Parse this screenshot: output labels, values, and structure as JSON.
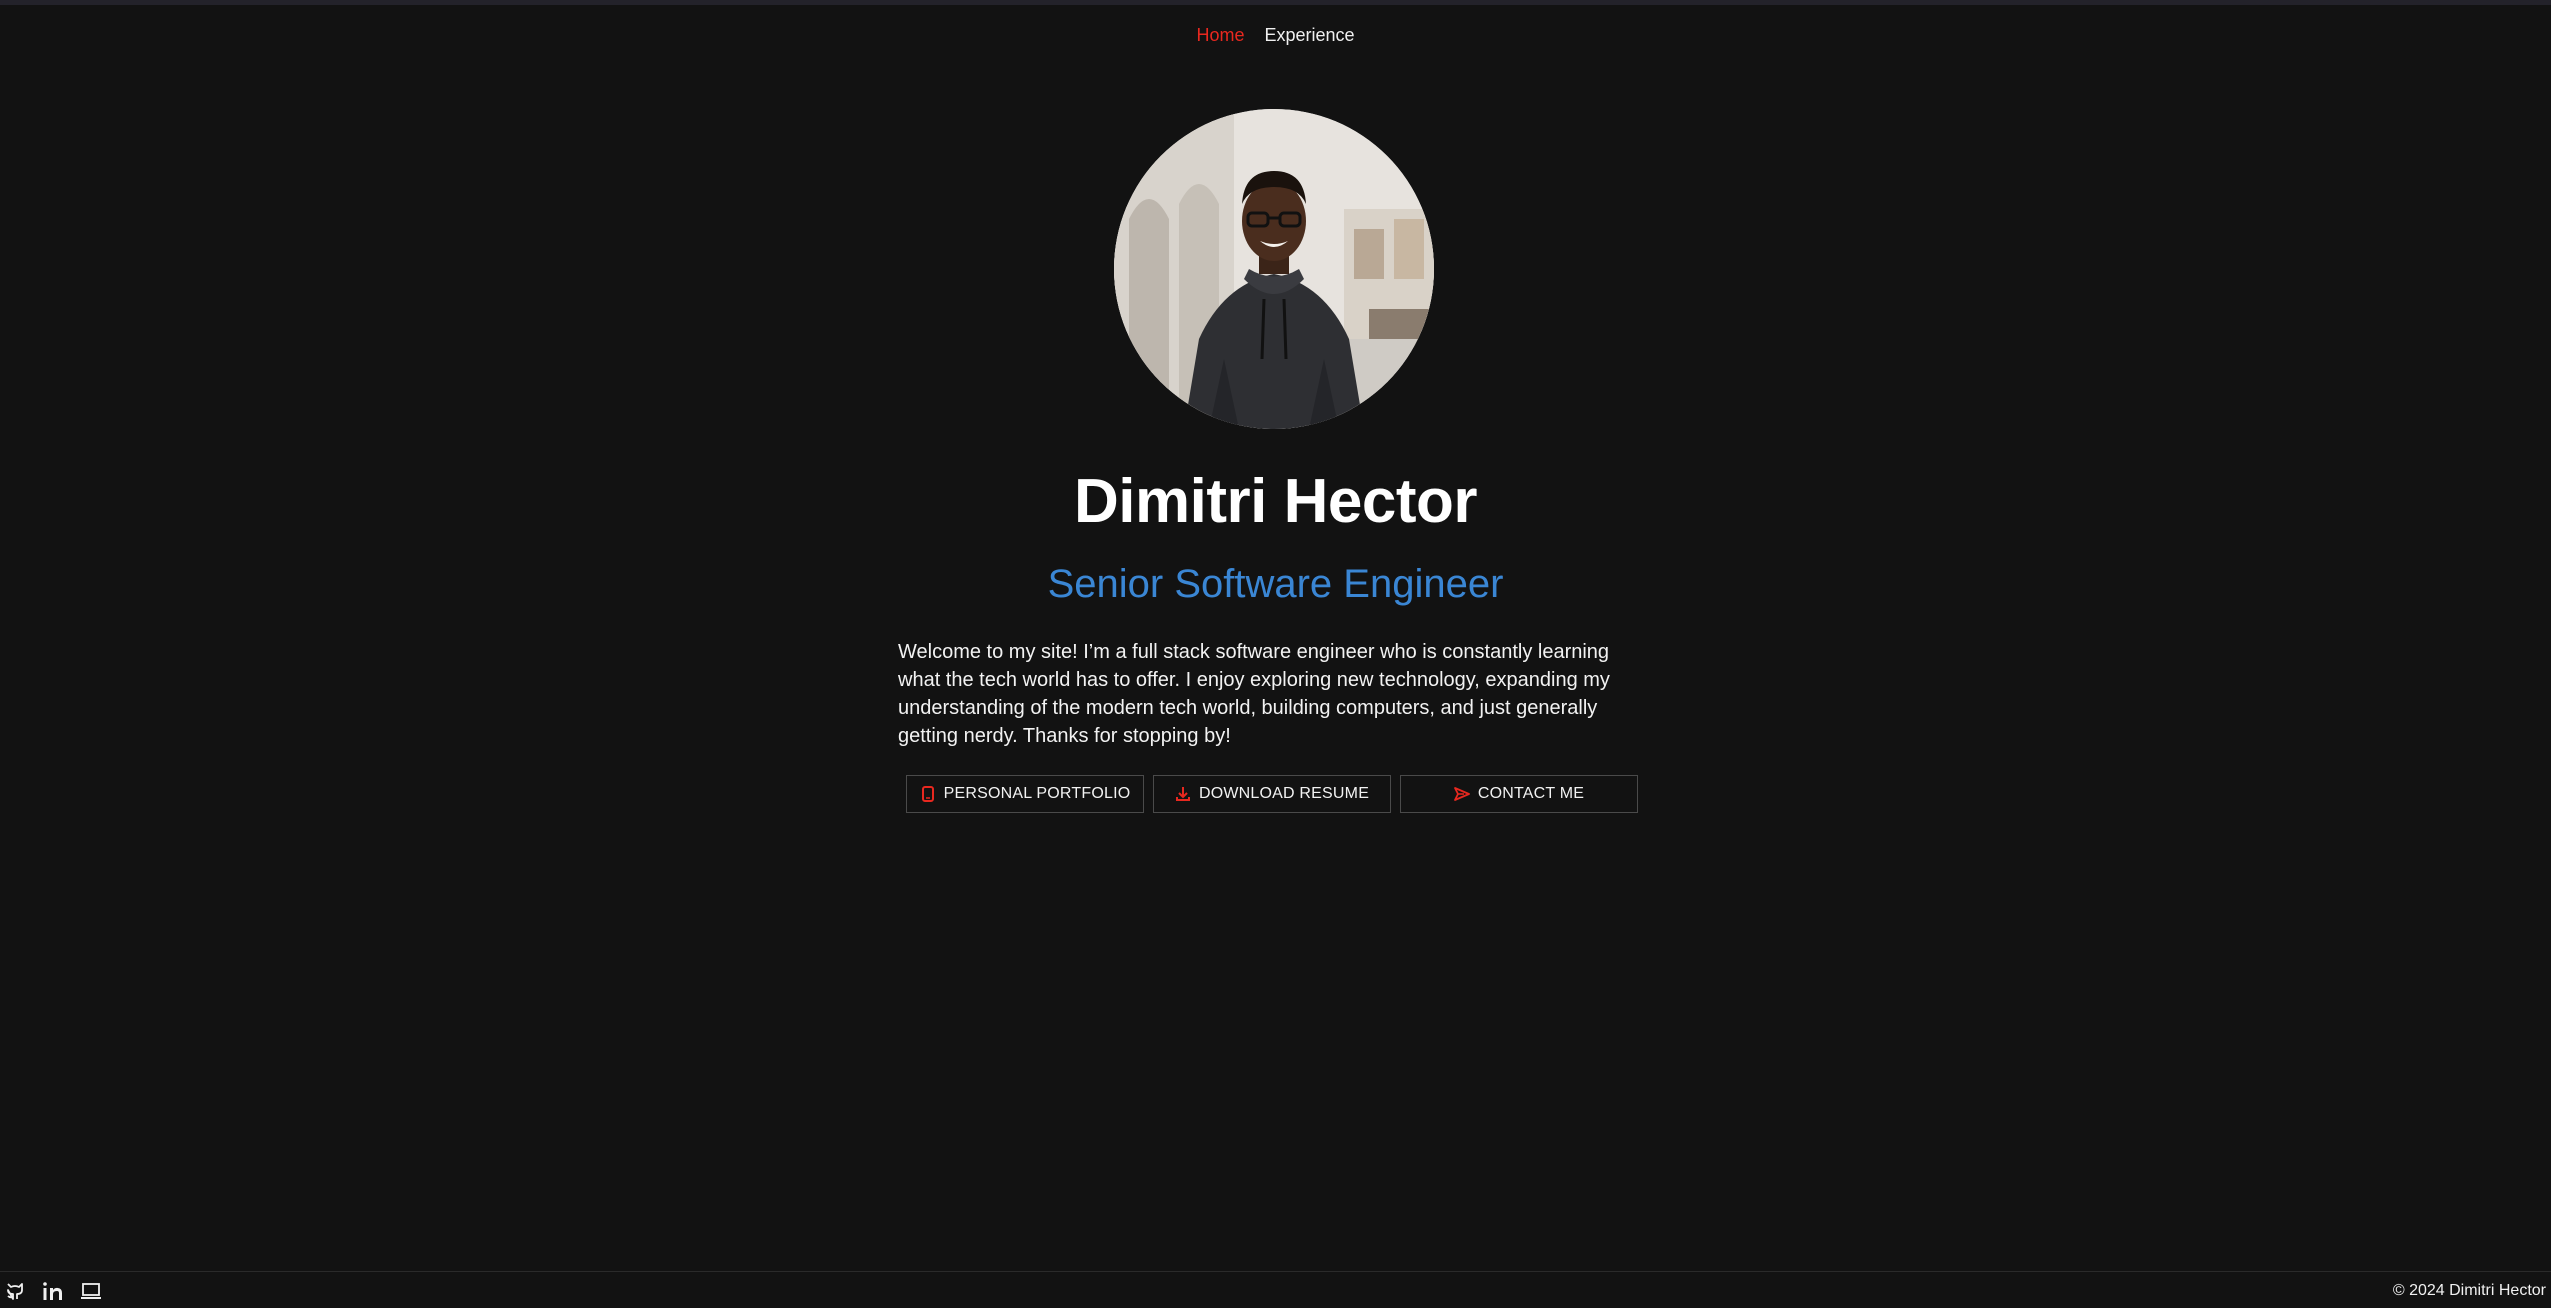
{
  "nav": {
    "items": [
      {
        "label": "Home",
        "active": true
      },
      {
        "label": "Experience",
        "active": false
      }
    ]
  },
  "profile": {
    "name": "Dimitri Hector",
    "role": "Senior Software Engineer",
    "bio": "Welcome to my site! I’m a full stack software engineer who is constantly learning what the tech world has to offer. I enjoy exploring new technology, expanding my understanding of the modern tech world, building computers, and just generally getting nerdy. Thanks for stopping by!",
    "avatar_icon": "profile-photo"
  },
  "buttons": [
    {
      "label": "PERSONAL PORTFOLIO",
      "icon": "phone-icon"
    },
    {
      "label": "DOWNLOAD RESUME",
      "icon": "download-icon"
    },
    {
      "label": "CONTACT ME",
      "icon": "send-icon"
    }
  ],
  "footer": {
    "icons": [
      "github-icon",
      "linkedin-icon",
      "laptop-icon"
    ],
    "copyright": "© 2024 Dimitri Hector"
  },
  "colors": {
    "background": "#121212",
    "accent_red": "#e8281f",
    "accent_blue": "#3a86d4",
    "text": "#f2f2f2"
  }
}
